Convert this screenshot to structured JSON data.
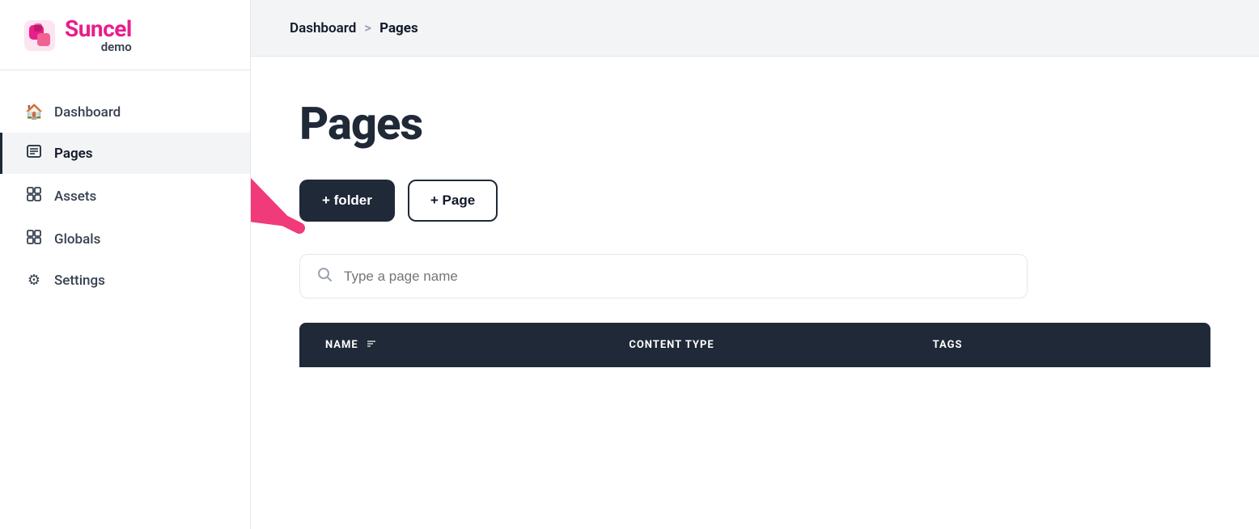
{
  "logo": {
    "name": "Suncel",
    "demo": "demo"
  },
  "breadcrumb": {
    "parent": "Dashboard",
    "separator": ">",
    "current": "Pages"
  },
  "nav": {
    "items": [
      {
        "id": "dashboard",
        "label": "Dashboard",
        "icon": "🏠",
        "active": false
      },
      {
        "id": "pages",
        "label": "Pages",
        "icon": "📋",
        "active": true
      },
      {
        "id": "assets",
        "label": "Assets",
        "icon": "🖼",
        "active": false
      },
      {
        "id": "globals",
        "label": "Globals",
        "icon": "⊞",
        "active": false
      },
      {
        "id": "settings",
        "label": "Settings",
        "icon": "⚙",
        "active": false
      }
    ]
  },
  "page": {
    "title": "Pages",
    "buttons": {
      "folder": "+ folder",
      "page": "+ Page"
    },
    "search": {
      "placeholder": "Type a page name"
    },
    "table": {
      "columns": [
        {
          "id": "name",
          "label": "NAME",
          "sortable": true
        },
        {
          "id": "content_type",
          "label": "CONTENT TYPE",
          "sortable": false
        },
        {
          "id": "tags",
          "label": "TAGS",
          "sortable": false
        }
      ]
    }
  },
  "colors": {
    "accent_pink": "#e91e8c",
    "dark_navy": "#1f2937",
    "white": "#ffffff",
    "arrow_pink": "#f03a7a"
  }
}
